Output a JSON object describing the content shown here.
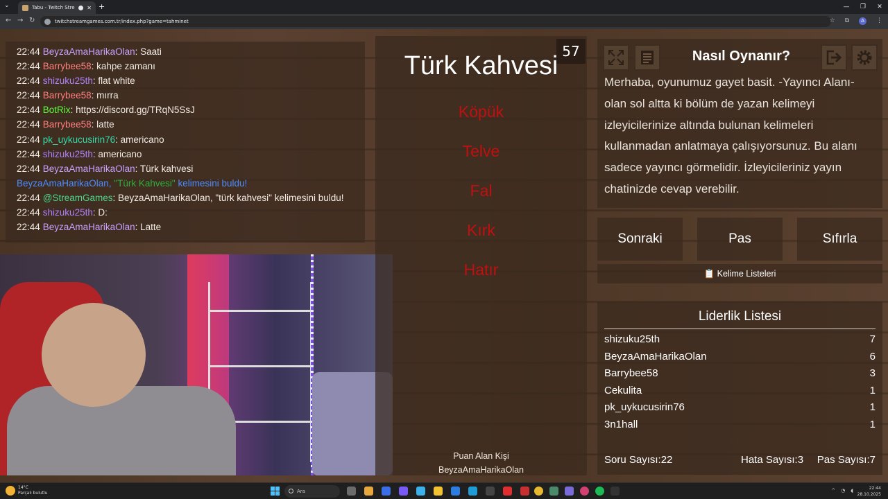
{
  "browser": {
    "tab_title": "Tabu - Twitch Stream Games",
    "url": "twitchstreamgames.com.tr/index.php?game=tahminet",
    "profile_initial": "A"
  },
  "chat": [
    {
      "time": "22:44",
      "user": "BeyzaAmaHarikaOlan",
      "user_color": "#c9a0ff",
      "sep": ": ",
      "msg": "Saati",
      "msg_color": "#f2ece4"
    },
    {
      "time": "22:44",
      "user": "Barrybee58",
      "user_color": "#ff7f7f",
      "sep": ": ",
      "msg": "kahpe zamanı",
      "msg_color": "#f2ece4"
    },
    {
      "time": "22:44",
      "user": "shizuku25th",
      "user_color": "#b080ff",
      "sep": ": ",
      "msg": "flat white",
      "msg_color": "#f2ece4"
    },
    {
      "time": "22:44",
      "user": "Barrybee58",
      "user_color": "#ff7f7f",
      "sep": ": ",
      "msg": "mırra",
      "msg_color": "#f2ece4"
    },
    {
      "time": "22:44",
      "user": "BotRix",
      "user_color": "#5cff3c",
      "sep": ": ",
      "msg": "https://discord.gg/TRqN5SsJ",
      "msg_color": "#f2ece4"
    },
    {
      "time": "22:44",
      "user": "Barrybee58",
      "user_color": "#ff7f7f",
      "sep": ": ",
      "msg": "latte",
      "msg_color": "#f2ece4"
    },
    {
      "time": "22:44",
      "user": "pk_uykucusirin76",
      "user_color": "#33ddaa",
      "sep": ": ",
      "msg": "americano",
      "msg_color": "#f2ece4"
    },
    {
      "time": "22:44",
      "user": "shizuku25th",
      "user_color": "#b080ff",
      "sep": ": ",
      "msg": "americano",
      "msg_color": "#f2ece4"
    },
    {
      "time": "22:44",
      "user": "BeyzaAmaHarikaOlan",
      "user_color": "#c9a0ff",
      "sep": ": ",
      "msg": "Türk kahvesi",
      "msg_color": "#f2ece4"
    },
    {
      "time": "",
      "user": "BeyzaAmaHarikaOlan, \"Türk Kahvesi\"",
      "user_color": "#4c8cff",
      "sep": " ",
      "msg": "kelimesini buldu!",
      "msg_color": "#4c8cff",
      "highlight": "\"Türk Kahvesi\""
    },
    {
      "time": "22:44",
      "user": "@StreamGames",
      "user_color": "#4cd98a",
      "sep": ": ",
      "msg": "BeyzaAmaHarikaOlan, \"türk kahvesi\" kelimesini buldu!",
      "msg_color": "#f2ece4"
    },
    {
      "time": "22:44",
      "user": "shizuku25th",
      "user_color": "#b080ff",
      "sep": ": ",
      "msg": "D:",
      "msg_color": "#f2ece4"
    },
    {
      "time": "22:44",
      "user": "BeyzaAmaHarikaOlan",
      "user_color": "#c9a0ff",
      "sep": ": ",
      "msg": "Latte",
      "msg_color": "#f2ece4"
    }
  ],
  "game": {
    "word": "Türk Kahvesi",
    "timer": "57",
    "taboo_words": [
      "Köpük",
      "Telve",
      "Fal",
      "Kırk",
      "Hatır"
    ],
    "scorer_label": "Puan Alan Kişi",
    "scorer_name": "BeyzaAmaHarikaOlan"
  },
  "howto": {
    "title": "Nasıl Oynanır?",
    "text": "Merhaba, oyunumuz gayet basit. -Yayıncı Alanı- olan sol altta ki bölüm de yazan kelimeyi izleyicilerinize altında bulunan kelimeleri kullanmadan anlatmaya çalışıyorsunuz. Bu alanı sadece yayıncı görmelidir. İzleyicileriniz yayın chatinizde cevap verebilir."
  },
  "buttons": {
    "next": "Sonraki",
    "pass": "Pas",
    "reset": "Sıfırla",
    "word_lists": "📋 Kelime Listeleri"
  },
  "leaderboard": {
    "title": "Liderlik Listesi",
    "rows": [
      {
        "name": "shizuku25th",
        "score": "7"
      },
      {
        "name": "BeyzaAmaHarikaOlan",
        "score": "6"
      },
      {
        "name": "Barrybee58",
        "score": "3"
      },
      {
        "name": "Cekulita",
        "score": "1"
      },
      {
        "name": "pk_uykucusirin76",
        "score": "1"
      },
      {
        "name": "3n1hall",
        "score": "1"
      }
    ],
    "stats": {
      "questions": "Soru Sayısı:22",
      "errors": "Hata Sayısı:3",
      "passes": "Pas Sayısı:7"
    }
  },
  "taskbar": {
    "weather_temp": "14°C",
    "weather_desc": "Parçalı bulutlu",
    "search_placeholder": "Ara",
    "time": "22:44",
    "date": "28.10.2025"
  }
}
